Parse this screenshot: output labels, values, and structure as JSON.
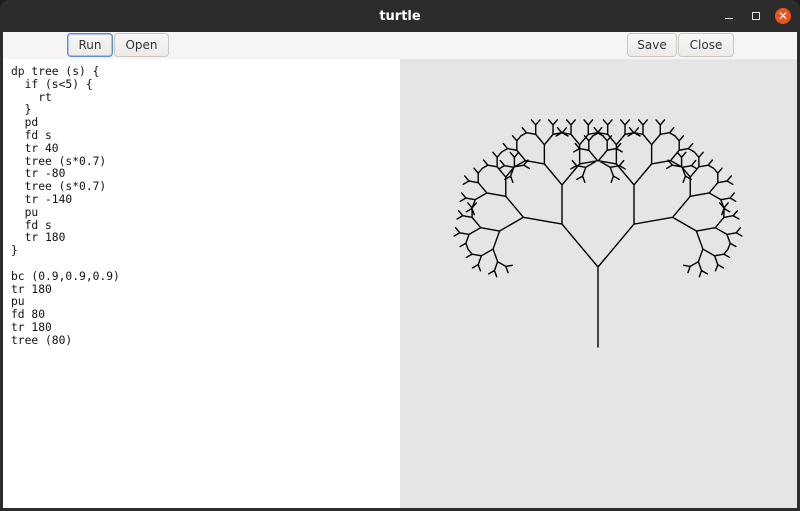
{
  "window": {
    "title": "turtle",
    "controls": {
      "minimize_icon": "minimize-icon",
      "maximize_icon": "maximize-icon",
      "close_icon": "close-icon",
      "close_glyph": "✕",
      "close_color": "#e95420"
    }
  },
  "toolbar": {
    "run_label": "Run",
    "open_label": "Open",
    "save_label": "Save",
    "close_label": "Close"
  },
  "editor": {
    "code": "dp tree (s) {\n  if (s<5) {\n    rt\n  }\n  pd\n  fd s\n  tr 40\n  tree (s*0.7)\n  tr -80\n  tree (s*0.7)\n  tr -140\n  pu\n  fd s\n  tr 180\n}\n\nbc (0.9,0.9,0.9)\ntr 180\npu\nfd 80\ntr 180\ntree (80)"
  },
  "canvas": {
    "background": "#e5e5e5",
    "stroke": "#000000",
    "drawing": "fractal-tree",
    "trunk_length": 80,
    "branch_scale": 0.7,
    "branch_angle": 40,
    "min_length": 5
  }
}
